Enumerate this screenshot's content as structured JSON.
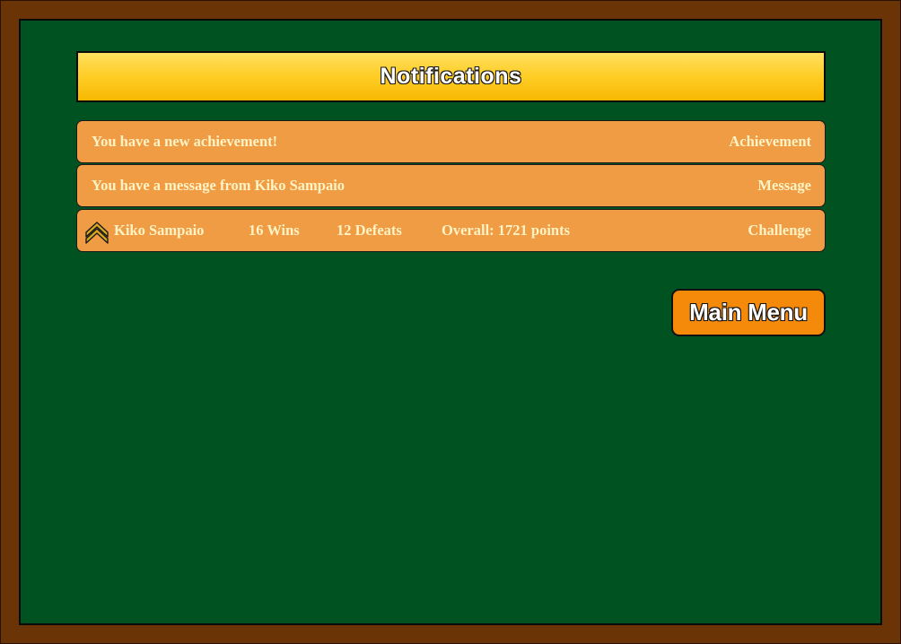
{
  "header": {
    "title": "Notifications"
  },
  "notifications": [
    {
      "message": "You have a new achievement!",
      "type": "Achievement"
    },
    {
      "message": "You have a message from Kiko Sampaio",
      "type": "Message"
    }
  ],
  "challenge": {
    "rank_icon": "sergeant-chevron-icon",
    "player": "Kiko Sampaio",
    "wins": "16 Wins",
    "defeats": "12 Defeats",
    "overall": "Overall: 1721 points",
    "type": "Challenge"
  },
  "actions": {
    "main_menu_label": "Main Menu"
  },
  "colors": {
    "frame": "#6b3406",
    "board": "#005220",
    "title_bar": "#ffcf2a",
    "notification_bg": "#f09c44",
    "notification_text": "#fff3c4",
    "button": "#f58a0a"
  }
}
